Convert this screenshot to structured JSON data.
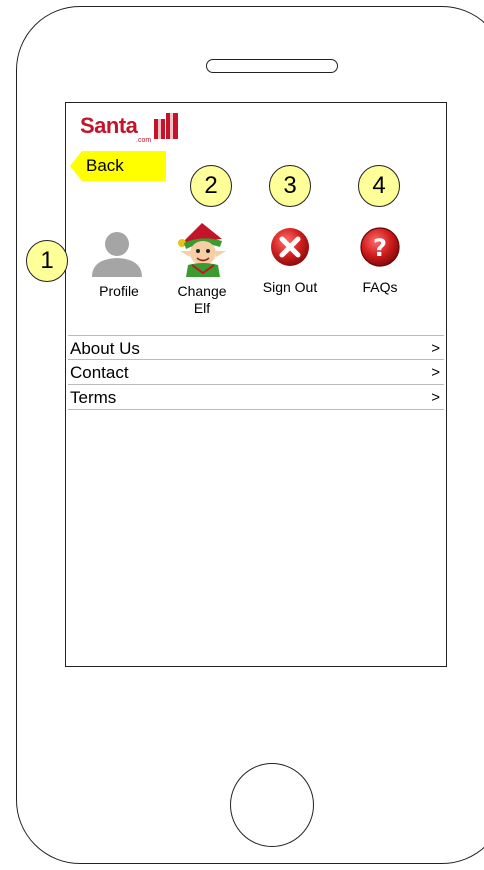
{
  "app": {
    "logo_text": "Santa",
    "logo_sub": ".com"
  },
  "back_label": "Back",
  "callouts": [
    "1",
    "2",
    "3",
    "4"
  ],
  "actions": [
    {
      "label": "Profile",
      "icon": "avatar-icon"
    },
    {
      "label": "Change Elf",
      "icon": "elf-icon"
    },
    {
      "label": "Sign Out",
      "icon": "close-circle-icon"
    },
    {
      "label": "FAQs",
      "icon": "question-circle-icon"
    }
  ],
  "menu": [
    {
      "label": "About Us",
      "arrow": ">"
    },
    {
      "label": "Contact",
      "arrow": ">"
    },
    {
      "label": "Terms",
      "arrow": ">"
    }
  ],
  "colors": {
    "brand_red": "#c4142a",
    "back_yellow": "#ffff00",
    "callout_yellow": "#ffff99"
  }
}
